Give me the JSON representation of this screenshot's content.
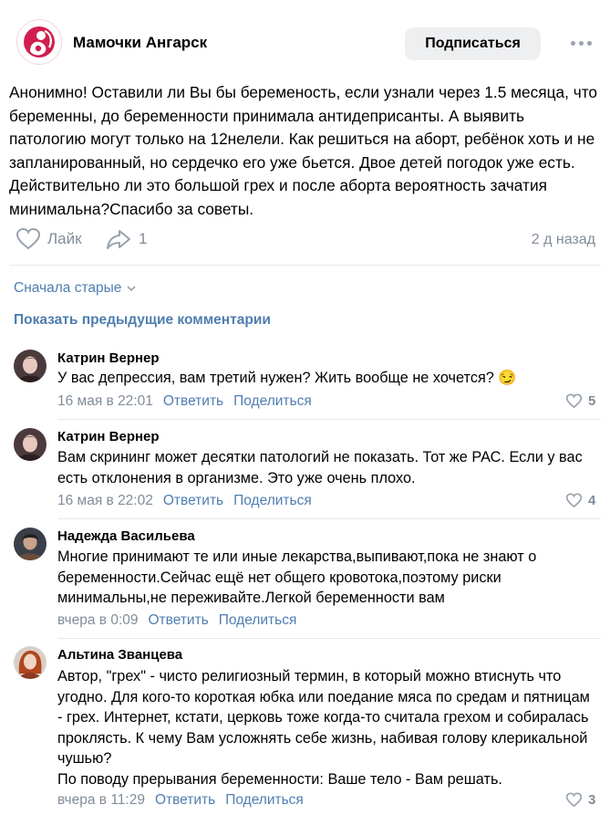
{
  "header": {
    "group_name": "Мамочки Ангарск",
    "subscribe_label": "Подписаться",
    "more_icon": "more-horizontal-icon",
    "accent_color": "#d01f4f"
  },
  "post": {
    "text": "Анонимно! Оставили ли Вы бы беременость, если узнали через 1.5 месяца, что беременны, до беременности принимала антидеприсанты. А выявить патологию могут только на 12нелели. Как решиться на аборт, ребёнок хоть и не запланированный, но сердечко его уже бьется. Двое детей погодок уже есть. Действительно ли это большой грех и после аборта вероятность зачатия минимальна?Спасибо за советы.",
    "like_label": "Лайк",
    "share_count": "1",
    "time": "2 д назад"
  },
  "comments_section": {
    "sort_label": "Сначала старые",
    "show_previous_label": "Показать предыдущие комментарии"
  },
  "comments": [
    {
      "author": "Катрин Вернер",
      "text": "У вас депрессия, вам третий нужен? Жить вообще не хочется? 😏",
      "date": "16 мая в 22:01",
      "reply": "Ответить",
      "share": "Поделиться",
      "likes": "5"
    },
    {
      "author": "Катрин Вернер",
      "text": "Вам скрининг может десятки патологий не показать. Тот же РАС. Если у вас есть отклонения в организме. Это уже очень плохо.",
      "date": "16 мая в 22:02",
      "reply": "Ответить",
      "share": "Поделиться",
      "likes": "4"
    },
    {
      "author": "Надежда Васильева",
      "text": "Многие принимают те или иные лекарства,выпивают,пока не знают о беременности.Сейчас ещё нет общего кровотока,поэтому риски минимальны,не переживайте.Легкой беременности вам",
      "date": "вчера в 0:09",
      "reply": "Ответить",
      "share": "Поделиться",
      "likes": ""
    },
    {
      "author": "Альтина Званцева",
      "text": "Автор, \"грех\" - чисто религиозный термин, в который можно втиснуть что угодно. Для кого-то короткая юбка или поедание мяса по средам и пятницам - грех. Интернет, кстати, церковь тоже когда-то считала грехом и собиралась проклясть. К чему Вам усложнять себе жизнь, набивая голову клерикальной чушью?\nПо поводу прерывания беременности: Ваше тело - Вам решать.",
      "date": "вчера в 11:29",
      "reply": "Ответить",
      "share": "Поделиться",
      "likes": "3"
    }
  ]
}
